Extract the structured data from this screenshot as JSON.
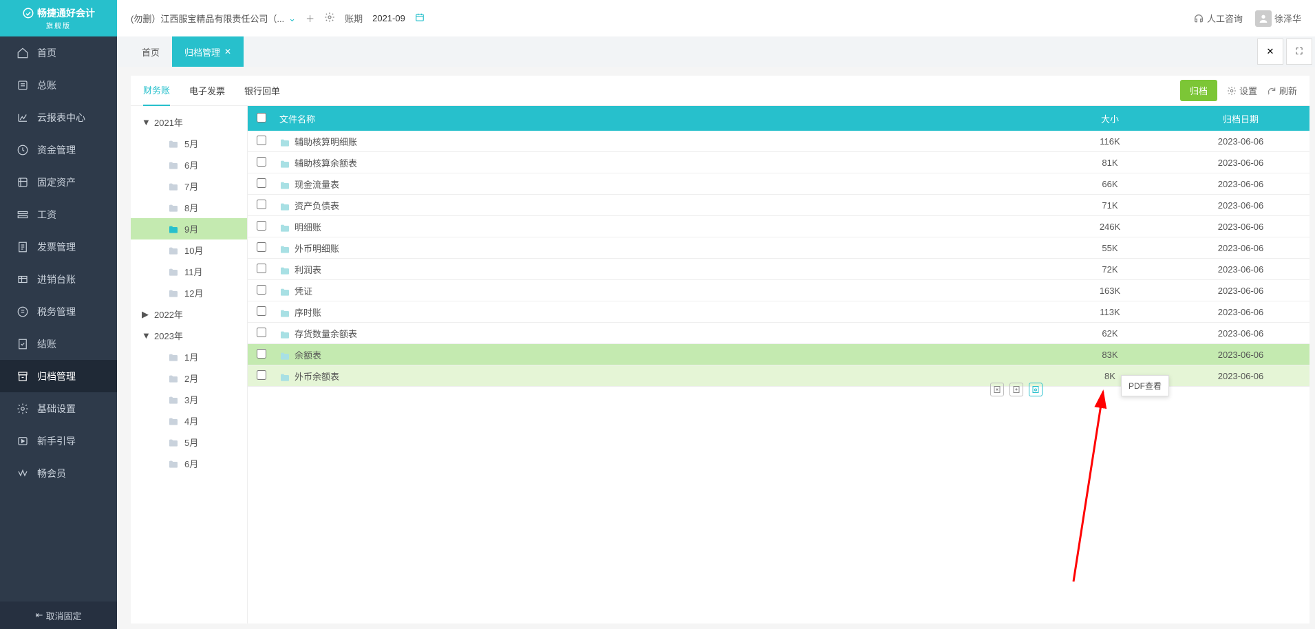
{
  "logo": {
    "line1": "畅捷通好会计",
    "line2": "旗舰版"
  },
  "nav": [
    {
      "label": "首页",
      "icon": "home"
    },
    {
      "label": "总账",
      "icon": "ledger"
    },
    {
      "label": "云报表中心",
      "icon": "chart"
    },
    {
      "label": "资金管理",
      "icon": "wallet"
    },
    {
      "label": "固定资产",
      "icon": "asset"
    },
    {
      "label": "工资",
      "icon": "salary"
    },
    {
      "label": "发票管理",
      "icon": "invoice"
    },
    {
      "label": "进销台账",
      "icon": "stock"
    },
    {
      "label": "税务管理",
      "icon": "tax"
    },
    {
      "label": "结账",
      "icon": "close"
    },
    {
      "label": "归档管理",
      "icon": "archive",
      "active": true
    },
    {
      "label": "基础设置",
      "icon": "gear"
    },
    {
      "label": "新手引导",
      "icon": "guide"
    },
    {
      "label": "畅会员",
      "icon": "vip"
    }
  ],
  "unpin": "取消固定",
  "header": {
    "company": "(勿删）江西服宝精品有限责任公司（...",
    "period_label": "账期",
    "period_value": "2021-09",
    "consult": "人工咨询",
    "user": "徐泽华"
  },
  "tabs": [
    {
      "label": "首页"
    },
    {
      "label": "归档管理",
      "active": true,
      "closable": true
    }
  ],
  "subtabs": {
    "items": [
      "财务账",
      "电子发票",
      "银行回单"
    ],
    "active": 0,
    "archive_btn": "归档",
    "settings": "设置",
    "refresh": "刷新"
  },
  "tree": [
    {
      "year": "2021年",
      "expanded": true,
      "months": [
        "5月",
        "6月",
        "7月",
        "8月",
        "9月",
        "10月",
        "11月",
        "12月"
      ],
      "selected": "9月"
    },
    {
      "year": "2022年",
      "expanded": false
    },
    {
      "year": "2023年",
      "expanded": true,
      "months": [
        "1月",
        "2月",
        "3月",
        "4月",
        "5月",
        "6月"
      ]
    }
  ],
  "table": {
    "headers": {
      "name": "文件名称",
      "size": "大小",
      "date": "归档日期"
    },
    "rows": [
      {
        "name": "辅助核算明细账",
        "size": "116K",
        "date": "2023-06-06"
      },
      {
        "name": "辅助核算余额表",
        "size": "81K",
        "date": "2023-06-06"
      },
      {
        "name": "现金流量表",
        "size": "66K",
        "date": "2023-06-06"
      },
      {
        "name": "资产负债表",
        "size": "71K",
        "date": "2023-06-06"
      },
      {
        "name": "明细账",
        "size": "246K",
        "date": "2023-06-06"
      },
      {
        "name": "外币明细账",
        "size": "55K",
        "date": "2023-06-06"
      },
      {
        "name": "利润表",
        "size": "72K",
        "date": "2023-06-06"
      },
      {
        "name": "凭证",
        "size": "163K",
        "date": "2023-06-06"
      },
      {
        "name": "序时账",
        "size": "113K",
        "date": "2023-06-06"
      },
      {
        "name": "存货数量余额表",
        "size": "62K",
        "date": "2023-06-06"
      },
      {
        "name": "余额表",
        "size": "83K",
        "date": "2023-06-06",
        "state": "selected"
      },
      {
        "name": "外币余额表",
        "size": "8K",
        "date": "2023-06-06",
        "state": "hover",
        "actions": true
      }
    ]
  },
  "tooltip": "PDF查看"
}
